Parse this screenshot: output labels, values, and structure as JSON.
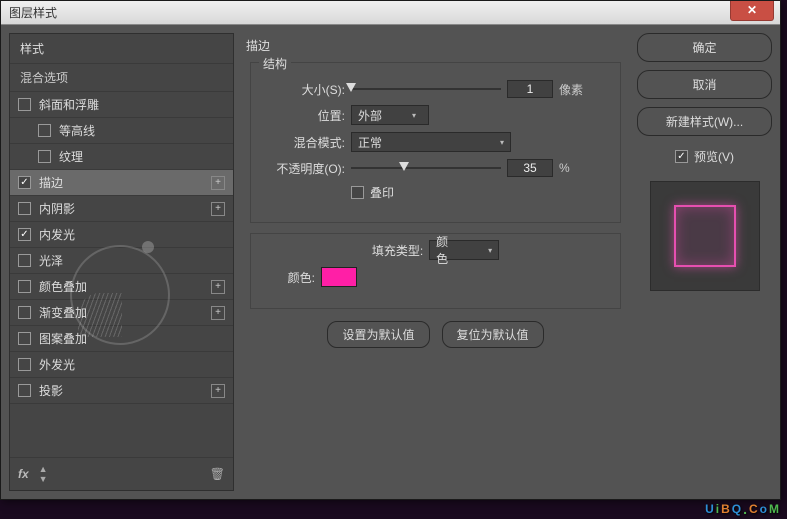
{
  "window": {
    "title": "图层样式"
  },
  "sidebar": {
    "header": "样式",
    "sub": "混合选项",
    "effects": [
      {
        "label": "斜面和浮雕",
        "checked": false,
        "plus": false,
        "indent": false
      },
      {
        "label": "等高线",
        "checked": false,
        "plus": false,
        "indent": true
      },
      {
        "label": "纹理",
        "checked": false,
        "plus": false,
        "indent": true
      },
      {
        "label": "描边",
        "checked": true,
        "plus": true,
        "indent": false,
        "active": true
      },
      {
        "label": "内阴影",
        "checked": false,
        "plus": true,
        "indent": false
      },
      {
        "label": "内发光",
        "checked": true,
        "plus": false,
        "indent": false
      },
      {
        "label": "光泽",
        "checked": false,
        "plus": false,
        "indent": false
      },
      {
        "label": "颜色叠加",
        "checked": false,
        "plus": true,
        "indent": false
      },
      {
        "label": "渐变叠加",
        "checked": false,
        "plus": true,
        "indent": false
      },
      {
        "label": "图案叠加",
        "checked": false,
        "plus": false,
        "indent": false
      },
      {
        "label": "外发光",
        "checked": false,
        "plus": false,
        "indent": false
      },
      {
        "label": "投影",
        "checked": false,
        "plus": true,
        "indent": false
      }
    ],
    "footer": {
      "fx": "fx"
    }
  },
  "main": {
    "title": "描边",
    "structure": {
      "title": "结构",
      "size": {
        "label": "大小(S):",
        "value": "1",
        "unit": "像素",
        "thumb_pct": 0
      },
      "position": {
        "label": "位置:",
        "value": "外部"
      },
      "blend": {
        "label": "混合模式:",
        "value": "正常"
      },
      "opacity": {
        "label": "不透明度(O):",
        "value": "35",
        "unit": "%",
        "thumb_pct": 35
      },
      "overprint": {
        "label": "叠印",
        "checked": false
      }
    },
    "fill": {
      "type": {
        "label": "填充类型:",
        "value": "颜色"
      },
      "color": {
        "label": "颜色:",
        "value": "#ff1fa6"
      }
    },
    "buttons": {
      "default": "设置为默认值",
      "reset": "复位为默认值"
    }
  },
  "right": {
    "ok": "确定",
    "cancel": "取消",
    "newStyle": "新建样式(W)...",
    "preview": "预览(V)"
  },
  "watermark": {
    "text": "UiBQ.CoM"
  }
}
